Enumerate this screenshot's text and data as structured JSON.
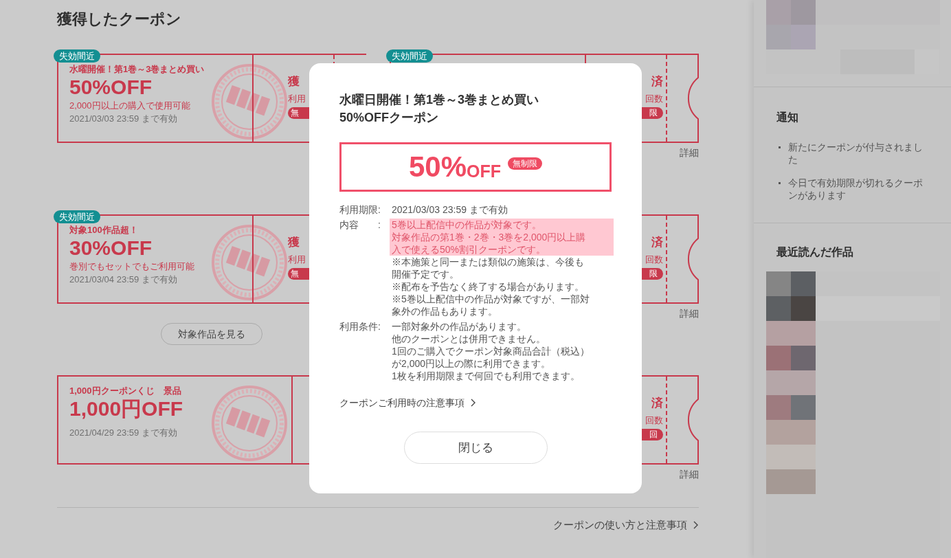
{
  "page_title": "獲得したクーポン",
  "coupon_groups": [
    {
      "rows": [
        {
          "left": {
            "kind": "campaign",
            "badge": "失効間近",
            "subtitle": "水曜開催！第1巻～3巻まとめ買い",
            "discount": "50%OFF",
            "condition": "2,000円以上の購入で使用可能",
            "expiry": "2021/03/03 23:59 まで有効",
            "stub_status": "獲",
            "stub_label": "利用",
            "stub_pill": "無"
          },
          "right": {
            "kind": "campaign",
            "badge": "失効間近",
            "stub_status": "済",
            "stub_label": "回数",
            "stub_pill": "限",
            "detail_link": "詳細"
          }
        },
        {
          "left": {
            "kind": "campaign",
            "badge": "失効間近",
            "subtitle": "対象100作品超！",
            "discount": "30%OFF",
            "condition": "巻別でもセットでもご利用可能",
            "expiry": "2021/03/04 23:59 まで有効",
            "stub_status": "獲",
            "stub_label": "利用",
            "stub_pill": "無"
          },
          "right": {
            "kind": "campaign",
            "stub_status": "済",
            "stub_label": "回数",
            "stub_pill": "限",
            "detail_link": "詳細"
          }
        }
      ],
      "button": "対象作品を見る"
    },
    {
      "rows": [
        {
          "left": {
            "kind": "prize",
            "subtitle": "1,000円クーポンくじ　景品",
            "discount": "1,000円OFF",
            "expiry": "2021/04/29 23:59 まで有効"
          },
          "right": {
            "kind": "prize",
            "stub_status": "済",
            "stub_label": "回数",
            "stub_pill": "回",
            "detail_link": "詳細"
          }
        }
      ]
    }
  ],
  "footer_link": "クーポンの使い方と注意事項",
  "sidebar": {
    "notifications": {
      "title": "通知",
      "items": [
        "新たにクーポンが付与されました",
        "今日で有効期限が切れるクーポンがあります"
      ]
    },
    "recent": {
      "title": "最近読んだ作品"
    }
  },
  "modal": {
    "title_lines": [
      "水曜日開催！第1巻～3巻まとめ買い",
      "50%OFFクーポン"
    ],
    "discount_value": "50%",
    "discount_unit": "OFF",
    "limit_badge": "無制限",
    "details": [
      {
        "label": "利用期限:",
        "lines": [
          {
            "text": "2021/03/03 23:59 まで有効",
            "highlighted": false
          }
        ]
      },
      {
        "label": "内容　　:",
        "lines": [
          {
            "text": "5巻以上配信中の作品が対象です。",
            "highlighted": true
          },
          {
            "text": "対象作品の第1巻・2巻・3巻を2,000円以上購",
            "highlighted": true
          },
          {
            "text": "入で使える50%割引クーポンです。",
            "highlighted": true
          },
          {
            "text": "※本施策と同一または類似の施策は、今後も",
            "highlighted": false
          },
          {
            "text": "開催予定です。",
            "highlighted": false
          },
          {
            "text": "※配布を予告なく終了する場合があります。",
            "highlighted": false
          },
          {
            "text": "※5巻以上配信中の作品が対象ですが、一部対",
            "highlighted": false
          },
          {
            "text": "象外の作品もあります。",
            "highlighted": false
          }
        ]
      },
      {
        "label": "利用条件:",
        "lines": [
          {
            "text": "一部対象外の作品があります。",
            "highlighted": false
          },
          {
            "text": "他のクーポンとは併用できません。",
            "highlighted": false
          },
          {
            "text": "1回のご購入でクーポン対象商品合計（税込）",
            "highlighted": false
          },
          {
            "text": "が2,000円以上の際に利用できます。",
            "highlighted": false
          },
          {
            "text": "1枚を利用期限まで何回でも利用できます。",
            "highlighted": false
          }
        ]
      }
    ],
    "notes_link": "クーポンご利用時の注意事項",
    "close_button": "閉じる"
  }
}
